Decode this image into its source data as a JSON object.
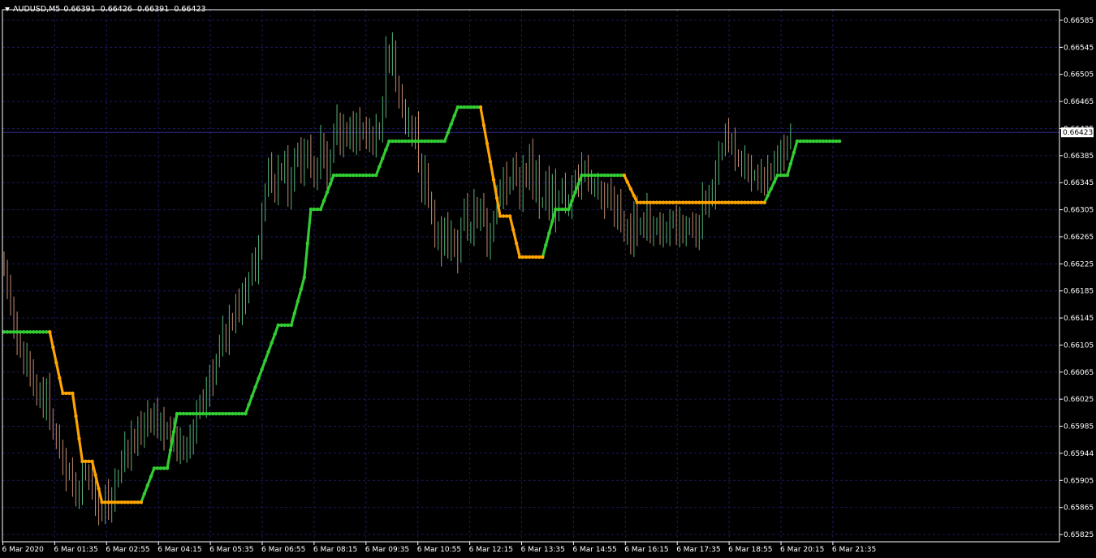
{
  "header": {
    "symbol": "AUDUSD,M5",
    "open": "0.66391",
    "high": "0.66426",
    "low": "0.66391",
    "close": "0.66423"
  },
  "colors": {
    "background": "#000000",
    "grid": "#1a1a5c",
    "axis": "#ffffff",
    "candle_up": "#55b377",
    "candle_down": "#c38b6e",
    "trend_up": "#32cd32",
    "trend_down": "#ffa500",
    "bid_line": "#2b2b8c"
  },
  "icons": {
    "menu": "triangle-down-icon"
  },
  "chart_data": {
    "type": "line",
    "title": "AUDUSD,M5",
    "y_ticks": [
      "0.66585",
      "0.66545",
      "0.66505",
      "0.66465",
      "0.66425",
      "0.66385",
      "0.66345",
      "0.66305",
      "0.66265",
      "0.66225",
      "0.66185",
      "0.66145",
      "0.66105",
      "0.66065",
      "0.66025",
      "0.65985",
      "0.65944",
      "0.65905",
      "0.65865",
      "0.65825"
    ],
    "x_ticks": [
      "6 Mar 2020",
      "6 Mar 01:35",
      "6 Mar 02:55",
      "6 Mar 04:15",
      "6 Mar 05:35",
      "6 Mar 06:55",
      "6 Mar 08:15",
      "6 Mar 09:35",
      "6 Mar 10:55",
      "6 Mar 12:15",
      "6 Mar 13:35",
      "6 Mar 14:55",
      "6 Mar 16:15",
      "6 Mar 17:35",
      "6 Mar 18:55",
      "6 Mar 20:15",
      "6 Mar 21:35"
    ],
    "current_price": "0.66423",
    "ylim": [
      0.65822,
      0.66603
    ],
    "grid": true,
    "candles_close": [
      0.6622,
      0.6619,
      0.6617,
      0.6614,
      0.6612,
      0.661,
      0.6608,
      0.6609,
      0.6607,
      0.6606,
      0.6603,
      0.6604,
      0.6602,
      0.6605,
      0.6601,
      0.6598,
      0.6597,
      0.6596,
      0.6594,
      0.6592,
      0.6593,
      0.659,
      0.6589,
      0.659,
      0.6593,
      0.6592,
      0.6591,
      0.659,
      0.6588,
      0.6587,
      0.6586,
      0.6589,
      0.6587,
      0.6589,
      0.6591,
      0.6592,
      0.6594,
      0.6596,
      0.6595,
      0.6598,
      0.6596,
      0.6599,
      0.6598,
      0.66,
      0.6601,
      0.6599,
      0.6601,
      0.6599,
      0.66,
      0.6598,
      0.6599,
      0.6597,
      0.6598,
      0.6596,
      0.6597,
      0.6595,
      0.6596,
      0.6597,
      0.6599,
      0.6601,
      0.6603,
      0.6602,
      0.6604,
      0.6607,
      0.6606,
      0.6609,
      0.6611,
      0.6613,
      0.6612,
      0.6615,
      0.6614,
      0.6617,
      0.6616,
      0.6619,
      0.6618,
      0.6621,
      0.6623,
      0.6622,
      0.6626,
      0.663,
      0.6634,
      0.6637,
      0.6635,
      0.6634,
      0.6637,
      0.6636,
      0.6638,
      0.6633,
      0.6636,
      0.6638,
      0.664,
      0.6636,
      0.6639,
      0.664,
      0.6638,
      0.6635,
      0.6637,
      0.6641,
      0.6639,
      0.6636,
      0.6639,
      0.6642,
      0.6644,
      0.6641,
      0.6643,
      0.6641,
      0.6643,
      0.6641,
      0.6644,
      0.6642,
      0.6643,
      0.6641,
      0.6642,
      0.6641,
      0.6643,
      0.6642,
      0.6646,
      0.6654,
      0.6653,
      0.6655,
      0.6649,
      0.6647,
      0.6646,
      0.6644,
      0.6644,
      0.6641,
      0.6643,
      0.6638,
      0.6634,
      0.6637,
      0.6632,
      0.663,
      0.6627,
      0.6628,
      0.6625,
      0.6629,
      0.6625,
      0.6627,
      0.6626,
      0.6624,
      0.6629,
      0.6631,
      0.6628,
      0.6628,
      0.6632,
      0.6629,
      0.6631,
      0.663,
      0.6626,
      0.6627,
      0.663,
      0.6633,
      0.6633,
      0.6636,
      0.6634,
      0.6635,
      0.6637,
      0.6636,
      0.6633,
      0.6637,
      0.6635,
      0.6639,
      0.6634,
      0.6637,
      0.6632,
      0.6632,
      0.6635,
      0.6631,
      0.6635,
      0.663,
      0.6633,
      0.6634,
      0.6632,
      0.6632,
      0.6634,
      0.6636,
      0.6634,
      0.6637,
      0.6637,
      0.6636,
      0.6634,
      0.6634,
      0.6634,
      0.6633,
      0.6632,
      0.6634,
      0.6632,
      0.663,
      0.6632,
      0.663,
      0.6627,
      0.6628,
      0.6626,
      0.6631,
      0.6628,
      0.6629,
      0.6628,
      0.6631,
      0.6628,
      0.6628,
      0.6629,
      0.6627,
      0.6628,
      0.6628,
      0.6629,
      0.663,
      0.6627,
      0.6629,
      0.6628,
      0.6628,
      0.6629,
      0.6628,
      0.6627,
      0.6629,
      0.6633,
      0.6631,
      0.6633,
      0.6633,
      0.6637,
      0.6639,
      0.664,
      0.6642,
      0.6641,
      0.6641,
      0.6639,
      0.6638,
      0.6637,
      0.6638,
      0.6637,
      0.6636,
      0.6636,
      0.6635,
      0.6636,
      0.6635,
      0.6637,
      0.6636,
      0.6638,
      0.6638,
      0.664,
      0.6639,
      0.6641,
      0.6642
    ],
    "series": [
      {
        "color": "#32cd32",
        "segments": [
          [
            [
              0,
              0.6613
            ],
            [
              14,
              0.6613
            ]
          ],
          [
            [
              42,
              0.6588
            ],
            [
              46,
              0.6593
            ],
            [
              50,
              0.6593
            ],
            [
              53,
              0.6601
            ],
            [
              74,
              0.6601
            ]
          ],
          [
            [
              74,
              0.6601
            ],
            [
              84,
              0.6614
            ],
            [
              88,
              0.6614
            ],
            [
              92,
              0.6621
            ],
            [
              94,
              0.6631
            ],
            [
              97,
              0.6631
            ],
            [
              101,
              0.6636
            ],
            [
              114,
              0.6636
            ],
            [
              118,
              0.6641
            ],
            [
              135,
              0.6641
            ],
            [
              139,
              0.6646
            ],
            [
              146,
              0.6646
            ]
          ],
          [
            [
              165,
              0.6624
            ],
            [
              169,
              0.6631
            ],
            [
              173,
              0.6631
            ],
            [
              177,
              0.6636
            ],
            [
              190,
              0.6636
            ]
          ],
          [
            [
              233,
              0.6632
            ],
            [
              237,
              0.6636
            ],
            [
              240,
              0.6636
            ],
            [
              243,
              0.6641
            ],
            [
              256,
              0.6641
            ]
          ]
        ]
      },
      {
        "color": "#ffa500",
        "segments": [
          [
            [
              14,
              0.6613
            ],
            [
              18,
              0.6604
            ],
            [
              21,
              0.6604
            ],
            [
              24,
              0.6594
            ],
            [
              27,
              0.6594
            ],
            [
              30,
              0.6588
            ],
            [
              42,
              0.6588
            ]
          ],
          [
            [
              146,
              0.6646
            ],
            [
              149,
              0.6638
            ],
            [
              152,
              0.663
            ],
            [
              155,
              0.663
            ],
            [
              158,
              0.6624
            ],
            [
              165,
              0.6624
            ]
          ],
          [
            [
              190,
              0.6636
            ],
            [
              194,
              0.6632
            ],
            [
              233,
              0.6632
            ]
          ]
        ]
      }
    ]
  }
}
